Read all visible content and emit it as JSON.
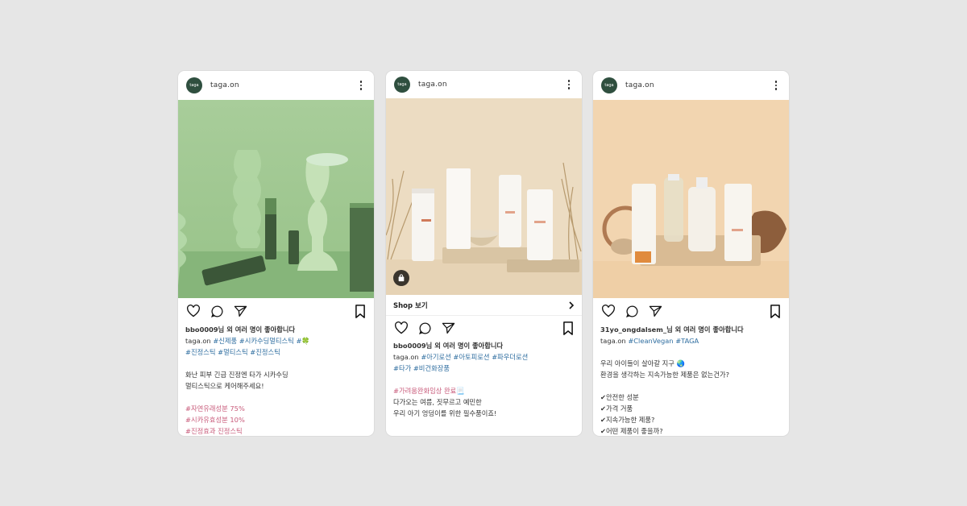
{
  "posts": [
    {
      "avatar_text": "taga",
      "username": "taga.on",
      "liked_by": "bbo0009님 외 여러 명이 좋아합니다",
      "caption": {
        "author": "taga.on",
        "tags1": "#신제품 #시카수딩멀티스틱 #",
        "tags2": "#진정스틱 #멀티스틱 #진정스틱",
        "line1": "화난 피부 긴급 진정엔 타가 시카수딩",
        "line2": "멀티스틱으로 케어해주세요!",
        "stat1": "#자연유래성분 75%",
        "stat2": "#시카유효성분 10%",
        "stat3": "#진정효과 진정스틱"
      }
    },
    {
      "avatar_text": "taga",
      "username": "taga.on",
      "shop_label": "Shop 보기",
      "liked_by": "bbo0009님 외 여러 명이 좋아합니다",
      "caption": {
        "author": "taga.on",
        "tags1": "#아기로션 #아토피로션 #파우더로션",
        "tags2": "#타가 #비건화장품",
        "tags3": "#가려움완화임상 완료",
        "line1": "다가오는 여름, 짓무르고 예민한",
        "line2": "우리 아기 엉덩이를 위한 필수품이죠!"
      }
    },
    {
      "avatar_text": "taga",
      "username": "taga.on",
      "liked_by": "31yo_ongdalsem_님 외 여러 명이 좋아합니다",
      "caption": {
        "author": "taga.on",
        "tags1": "#CleanVegan #TAGA",
        "line1": "우리 아이들이 살아갈 지구 🌏",
        "line2": "환경을 생각하는 지속가능한 제품은 없는건가?",
        "check1": "✔안전한 성분",
        "check2": "✔가격 거품",
        "check3": "✔지속가능한 제품?",
        "check4": "✔어떤 제품이 좋을까?"
      }
    }
  ],
  "colors": {
    "background": "#e6e6e6",
    "hashtag": "#2f6ea0",
    "avatar": "#2f4f3f"
  }
}
